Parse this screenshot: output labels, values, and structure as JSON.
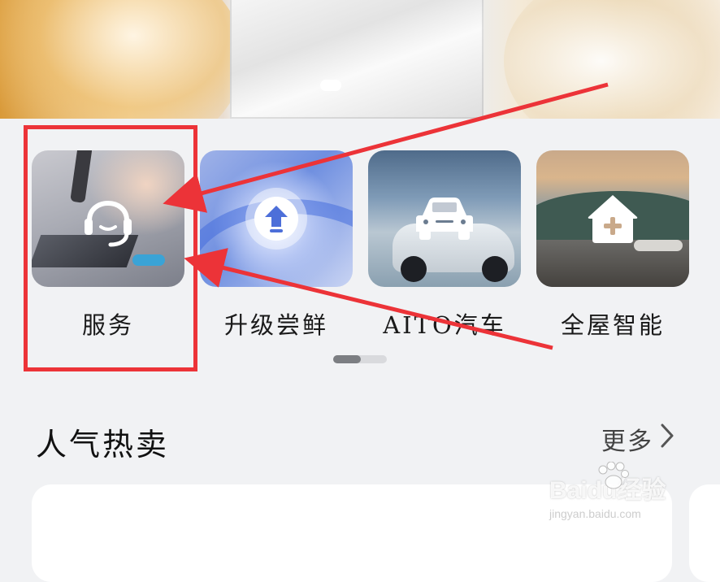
{
  "banner": {
    "page_count": 1
  },
  "shortcuts": [
    {
      "label": "服务",
      "icon": "headset-icon"
    },
    {
      "label": "升级尝鲜",
      "icon": "upgrade-arrow-icon"
    },
    {
      "label": "AITO汽车",
      "icon": "car-icon"
    },
    {
      "label": "全屋智能",
      "icon": "home-plus-icon"
    }
  ],
  "pager": {
    "current": 1,
    "total": 2
  },
  "section": {
    "title": "人气热卖",
    "more_label": "更多"
  },
  "watermark": {
    "main": "Baidu经验",
    "sub": "jingyan.baidu.com"
  },
  "colors": {
    "highlight": "#ec3338",
    "arrow": "#ec3338",
    "background": "#f1f2f4"
  }
}
